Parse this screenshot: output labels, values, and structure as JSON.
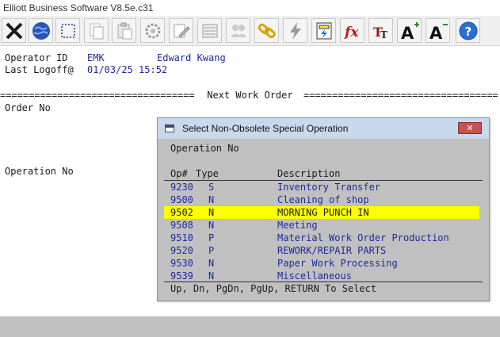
{
  "window": {
    "title": "Elliott Business Software V8.5e.c31"
  },
  "toolbar": {
    "buttons": [
      {
        "icon": "exit-icon"
      },
      {
        "icon": "globe-icon"
      },
      {
        "icon": "select-icon"
      },
      {
        "icon": "copy-icon"
      },
      {
        "icon": "paste-icon"
      },
      {
        "icon": "settings-icon"
      },
      {
        "icon": "edit-icon"
      },
      {
        "icon": "list-icon"
      },
      {
        "icon": "users-icon"
      },
      {
        "icon": "link-icon"
      },
      {
        "icon": "lightning-icon"
      },
      {
        "icon": "calculator-icon"
      },
      {
        "icon": "function-icon"
      },
      {
        "icon": "font-icon"
      },
      {
        "icon": "font-increase-icon"
      },
      {
        "icon": "font-decrease-icon"
      },
      {
        "icon": "help-icon"
      }
    ]
  },
  "operator": {
    "label": "Operator ID",
    "id": "EMK",
    "name": "Edward Kwang"
  },
  "logoff": {
    "label": "Last Logoff@",
    "value": "01/03/25 15:52"
  },
  "divider": {
    "left": "==================================",
    "title": " Next Work Order ",
    "right": "=================================="
  },
  "fields": {
    "order_no": "Order No",
    "operation_no": "Operation No"
  },
  "dialog": {
    "title": "Select Non-Obsolete Special Operation",
    "close": "✕",
    "prompt": "Operation No",
    "headers": {
      "op": "Op#",
      "type": "Type",
      "description": "Description"
    },
    "rows": [
      {
        "op": "9230",
        "type": "S",
        "description": "Inventory Transfer"
      },
      {
        "op": "9500",
        "type": "N",
        "description": "Cleaning of shop"
      },
      {
        "op": "9502",
        "type": "N",
        "description": "MORNING PUNCH IN"
      },
      {
        "op": "9508",
        "type": "N",
        "description": "Meeting"
      },
      {
        "op": "9510",
        "type": "P",
        "description": "Material Work Order Production"
      },
      {
        "op": "9520",
        "type": "P",
        "description": "REWORK/REPAIR PARTS"
      },
      {
        "op": "9530",
        "type": "N",
        "description": "Paper Work Processing"
      },
      {
        "op": "9539",
        "type": "N",
        "description": "Miscellaneous"
      }
    ],
    "footer": "Up, Dn, PgDn, PgUp, RETURN To Select"
  },
  "colors": {
    "highlight": "#ffff00",
    "terminal_blue": "#1f2a9a",
    "status_gray": "#c0c0c0"
  }
}
